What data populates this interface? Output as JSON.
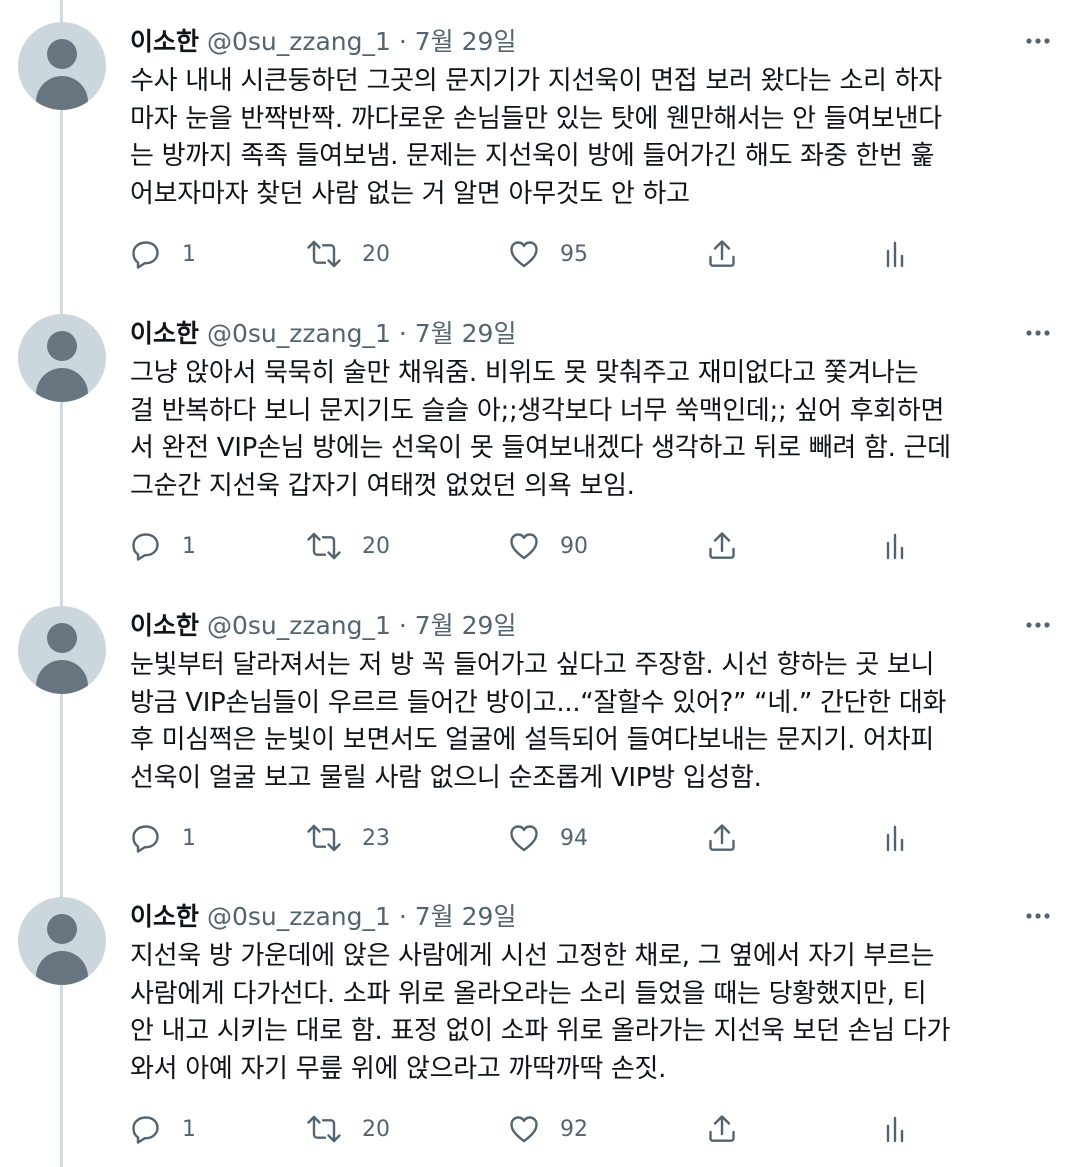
{
  "tweets": [
    {
      "name": "이소한",
      "handle": "@0su_zzang_1",
      "separator": " · ",
      "date": "7월 29일",
      "text": "수사 내내 시큰둥하던 그곳의 문지기가 지선욱이 면접 보러 왔다는 소리 하자\n마자 눈을 반짝반짝. 까다로운 손님들만 있는 탓에 웬만해서는 안 들여보낸다\n는 방까지 족족 들여보냄. 문제는 지선욱이 방에 들어가긴 해도 좌중 한번 훑\n어보자마자 찾던 사람 없는 거 알면 아무것도 안 하고",
      "reply_count": "1",
      "retweet_count": "20",
      "like_count": "95"
    },
    {
      "name": "이소한",
      "handle": "@0su_zzang_1",
      "separator": " · ",
      "date": "7월 29일",
      "text": "그냥 앉아서 묵묵히 술만 채워줌. 비위도 못 맞춰주고 재미없다고 쫓겨나는\n걸 반복하다 보니 문지기도 슬슬 아;;생각보다 너무 쑥맥인데;; 싶어 후회하면\n서 완전 VIP손님 방에는 선욱이 못 들여보내겠다 생각하고 뒤로 빼려 함. 근데\n그순간 지선욱 갑자기 여태껏 없었던 의욕 보임.",
      "reply_count": "1",
      "retweet_count": "20",
      "like_count": "90"
    },
    {
      "name": "이소한",
      "handle": "@0su_zzang_1",
      "separator": " · ",
      "date": "7월 29일",
      "text": "눈빛부터 달라져서는 저 방 꼭 들어가고 싶다고 주장함. 시선 향하는 곳 보니\n방금 VIP손님들이 우르르 들어간 방이고...“잘할수 있어?” “네.” 간단한 대화\n후 미심쩍은 눈빛이 보면서도 얼굴에 설득되어 들여다보내는 문지기. 어차피\n선욱이 얼굴 보고 물릴 사람 없으니 순조롭게 VIP방 입성함.",
      "reply_count": "1",
      "retweet_count": "23",
      "like_count": "94"
    },
    {
      "name": "이소한",
      "handle": "@0su_zzang_1",
      "separator": " · ",
      "date": "7월 29일",
      "text": "지선욱 방 가운데에 앉은 사람에게 시선 고정한 채로, 그 옆에서 자기 부르는\n사람에게 다가선다. 소파 위로 올라오라는 소리 들었을 때는 당황했지만, 티\n안 내고 시키는 대로 함. 표정 없이 소파 위로 올라가는 지선욱 보던 손님 다가\n와서 아예 자기 무릎 위에 앉으라고 까딱까딱 손짓.",
      "reply_count": "1",
      "retweet_count": "20",
      "like_count": "92"
    }
  ],
  "icons": {
    "more": "more-icon",
    "reply": "reply-icon",
    "retweet": "retweet-icon",
    "like": "heart-icon",
    "share": "share-icon",
    "analytics": "analytics-icon"
  },
  "colors": {
    "text": "#0f1419",
    "secondary": "#536471",
    "thread_line": "#cfd9de",
    "avatar_bg": "#ccd6dd",
    "avatar_fg": "#66757f"
  }
}
